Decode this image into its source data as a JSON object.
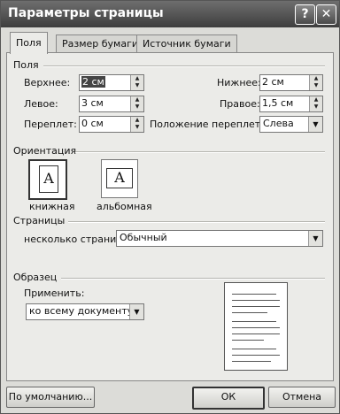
{
  "window": {
    "title": "Параметры страницы",
    "help_label": "?",
    "close_label": "✕"
  },
  "tabs": [
    {
      "label": "Поля"
    },
    {
      "label": "Размер бумаги"
    },
    {
      "label": "Источник бумаги"
    }
  ],
  "margins": {
    "group_title": "Поля",
    "top": {
      "label": "Верхнее:",
      "value": "2 см"
    },
    "bottom": {
      "label": "Нижнее:",
      "value": "2 см"
    },
    "left": {
      "label": "Левое:",
      "value": "3 см"
    },
    "right": {
      "label": "Правое:",
      "value": "1,5 см"
    },
    "gutter": {
      "label": "Переплет:",
      "value": "0 см"
    },
    "gutter_position": {
      "label": "Положение переплета:",
      "value": "Слева"
    }
  },
  "orientation": {
    "group_title": "Ориентация",
    "portrait": {
      "label": "книжная",
      "glyph": "A"
    },
    "landscape": {
      "label": "альбомная",
      "glyph": "A"
    }
  },
  "pages": {
    "group_title": "Страницы",
    "multiple_label": "несколько страниц:",
    "multiple_value": "Обычный"
  },
  "preview": {
    "group_title": "Образец",
    "apply_label": "Применить:",
    "apply_value": "ко всему документу"
  },
  "buttons": {
    "default": "По умолчанию...",
    "ok": "ОК",
    "cancel": "Отмена"
  }
}
